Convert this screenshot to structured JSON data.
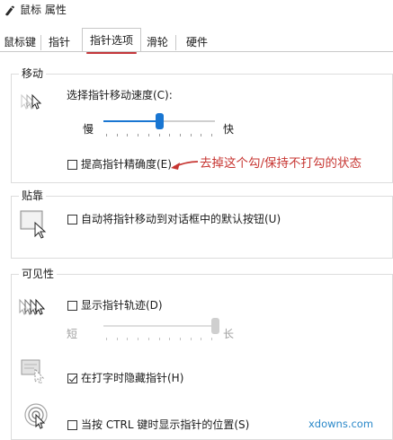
{
  "window": {
    "title": "鼠标 属性"
  },
  "tabs": [
    {
      "label": "鼠标键"
    },
    {
      "label": "指针"
    },
    {
      "label": "指针选项",
      "selected": true
    },
    {
      "label": "滑轮"
    },
    {
      "label": "硬件"
    }
  ],
  "motion": {
    "group_label": "移动",
    "speed_label": "选择指针移动速度(C):",
    "slow_label": "慢",
    "fast_label": "快",
    "speed_level_fraction": 0.5,
    "precision": {
      "label": "提高指针精确度(E)",
      "checked": false
    }
  },
  "annotation": {
    "text": "去掉这个勾/保持不打勾的状态",
    "color": "#c73632"
  },
  "snap_to": {
    "group_label": "贴靠",
    "option": {
      "label": "自动将指针移动到对话框中的默认按钮(U)",
      "checked": false
    }
  },
  "visibility": {
    "group_label": "可见性",
    "trails": {
      "label": "显示指针轨迹(D)",
      "checked": false
    },
    "short_label": "短",
    "long_label": "长",
    "trail_length_fraction": 1.0,
    "hide_typing": {
      "label": "在打字时隐藏指针(H)",
      "checked": true
    },
    "ctrl_locate": {
      "label": "当按 CTRL 键时显示指针的位置(S)",
      "checked": false
    }
  },
  "watermark": {
    "text": "xdowns.com"
  },
  "colors": {
    "accent": "#1976d2",
    "tab_underline": "#c4363a",
    "annotation": "#c73632",
    "watermark": "#2a88c9"
  },
  "icons": {
    "title": "mouse-icon",
    "motion": "pointer-speed-icon",
    "snap": "snap-to-default-icon",
    "trails": "pointer-trails-icon",
    "hide": "hide-pointer-icon",
    "locate": "locate-pointer-icon"
  }
}
